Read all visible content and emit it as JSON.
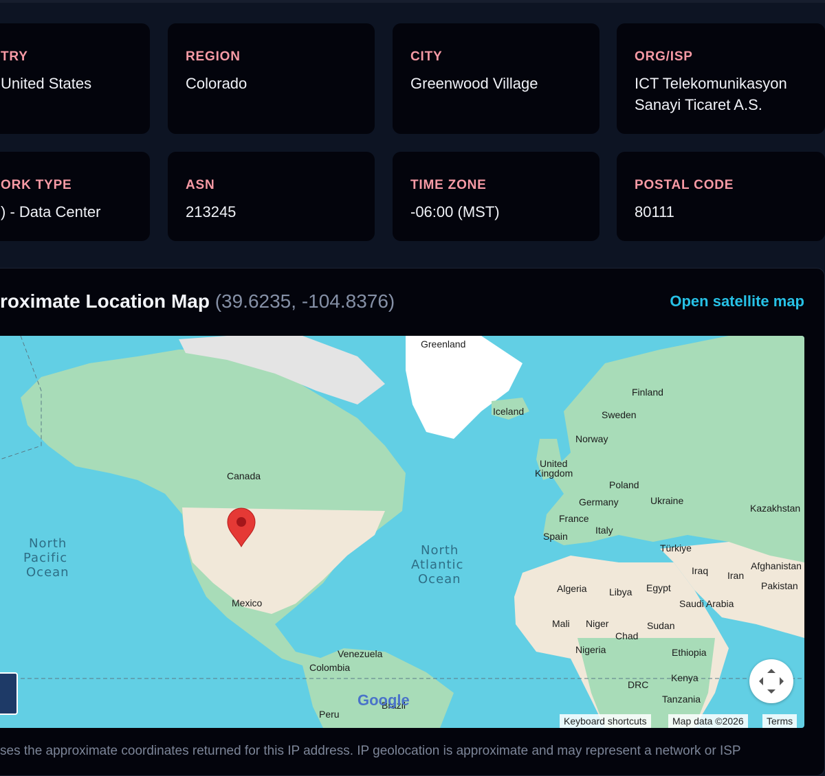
{
  "cards": [
    {
      "label": "TRY",
      "value": "United States"
    },
    {
      "label": "REGION",
      "value": "Colorado"
    },
    {
      "label": "CITY",
      "value": "Greenwood Village"
    },
    {
      "label": "ORG/ISP",
      "value": "ICT Telekomunikasyon",
      "value2": "Sanayi Ticaret A.S."
    },
    {
      "label": "ORK TYPE",
      "value": ") - Data Center"
    },
    {
      "label": "ASN",
      "value": "213245"
    },
    {
      "label": "TIME ZONE",
      "value": "-06:00 (MST)"
    },
    {
      "label": "POSTAL CODE",
      "value": "80111"
    }
  ],
  "map_section": {
    "title": "roximate Location Map",
    "coords": "(39.6235, -104.8376)",
    "open_link": "Open satellite map"
  },
  "map": {
    "labels": {
      "greenland": "Greenland",
      "iceland": "Iceland",
      "finland": "Finland",
      "sweden": "Sweden",
      "norway": "Norway",
      "united": "United",
      "kingdom": "Kingdom",
      "poland": "Poland",
      "germany": "Germany",
      "ukraine": "Ukraine",
      "kazakhstan": "Kazakhstan",
      "france": "France",
      "italy": "Italy",
      "spain": "Spain",
      "turkiye": "Türkiye",
      "iraq": "Iraq",
      "iran": "Iran",
      "afghanistan": "Afghanistan",
      "pakistan": "Pakistan",
      "algeria": "Algeria",
      "libya": "Libya",
      "egypt": "Egypt",
      "saudi": "Saudi Arabia",
      "mali": "Mali",
      "niger": "Niger",
      "chad": "Chad",
      "sudan": "Sudan",
      "nigeria": "Nigeria",
      "ethiopia": "Ethiopia",
      "drc": "DRC",
      "kenya": "Kenya",
      "tanzania": "Tanzania",
      "canada": "Canada",
      "mexico": "Mexico",
      "venezuela": "Venezuela",
      "colombia": "Colombia",
      "peru": "Peru",
      "brazil": "Brazil",
      "np1": "North",
      "np2": "Pacific",
      "np3": "Ocean",
      "na1": "North",
      "na2": "Atlantic",
      "na3": "Ocean",
      "google": "Google"
    },
    "attribution": {
      "shortcuts": "Keyboard shortcuts",
      "data": "Map data ©2026",
      "terms": "Terms"
    },
    "colors": {
      "water": "#62cfe4",
      "land": "#a8dcb8",
      "pin": "#e53935"
    }
  },
  "footnote": "ses the approximate coordinates returned for this IP address. IP geolocation is approximate and may represent a network or ISP"
}
